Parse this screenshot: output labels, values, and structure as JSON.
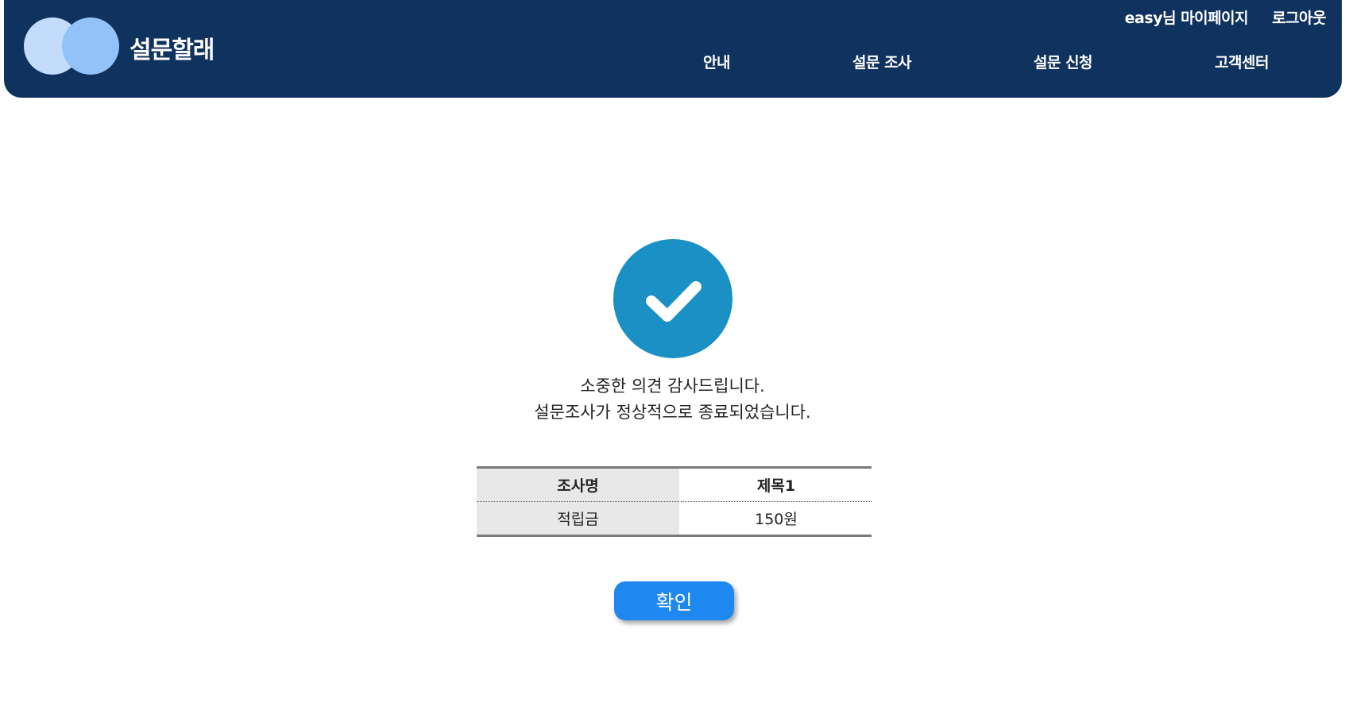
{
  "header": {
    "brand": "설문할래",
    "util": {
      "mypage": "easy님 마이페이지",
      "logout": "로그아웃"
    },
    "nav": [
      {
        "label": "안내"
      },
      {
        "label": "설문 조사"
      },
      {
        "label": "설문 신청"
      },
      {
        "label": "고객센터"
      }
    ]
  },
  "main": {
    "icon": "check-circle-icon",
    "message_line1": "소중한 의견 감사드립니다.",
    "message_line2": "설문조사가 정상적으로 종료되었습니다.",
    "table": {
      "rows": [
        {
          "label": "조사명",
          "value": "제목1"
        },
        {
          "label": "적립금",
          "value": "150원"
        }
      ]
    },
    "confirm_label": "확인"
  },
  "colors": {
    "header_bg": "#10325f",
    "check_bg": "#1a90c4",
    "button_bg": "#1e87f0"
  }
}
